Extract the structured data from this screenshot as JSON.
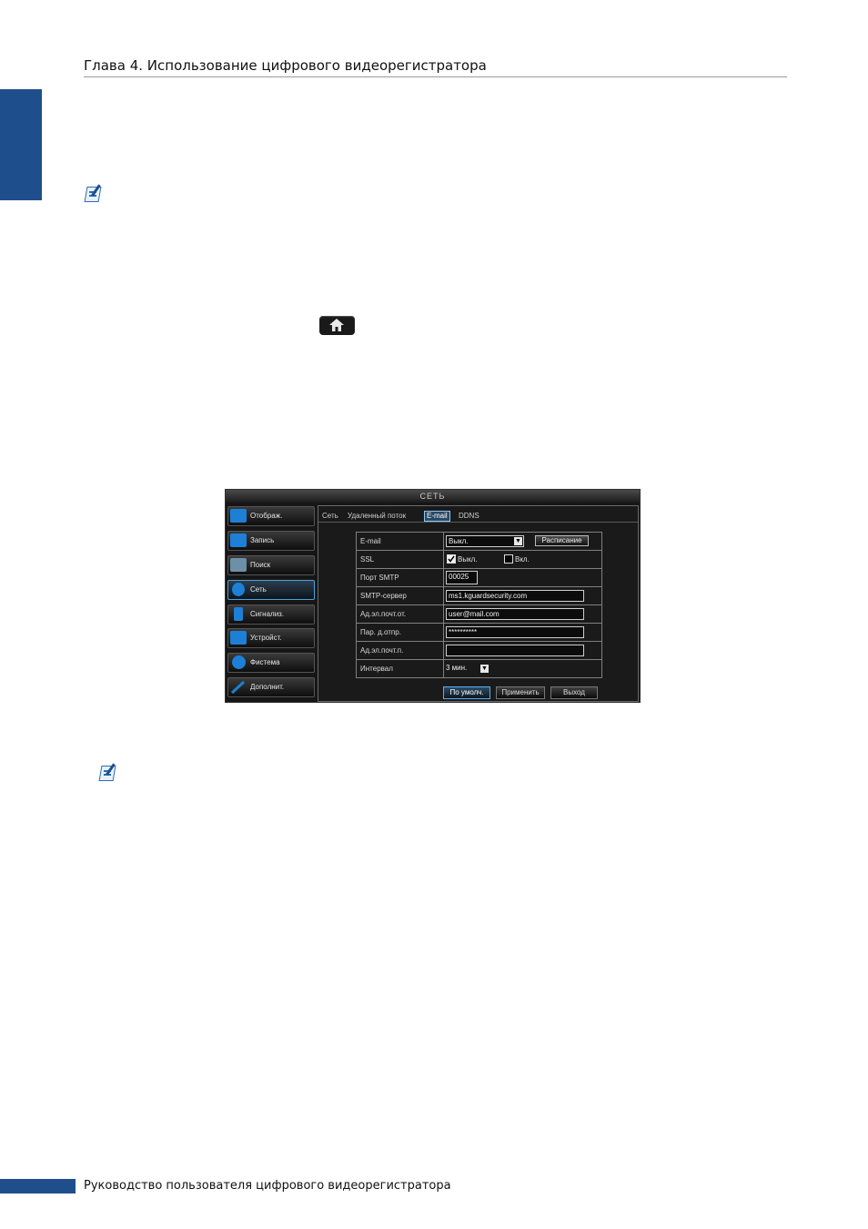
{
  "header": {
    "title": "Глава 4. Использование цифрового видеорегистратора"
  },
  "footer": {
    "text": "Руководство пользователя цифрового видеорегистратора"
  },
  "colors": {
    "accent": "#1f4e8c",
    "dvr_background": "#161616",
    "dvr_highlight": "#4aa3e0"
  },
  "icons": {
    "note": "note-pencil-icon",
    "home": "home-icon"
  },
  "dvr": {
    "title": "СЕТЬ",
    "menu": [
      {
        "label": "Отображ.",
        "icon": "display-icon",
        "icon_color": "#1e7fd6"
      },
      {
        "label": "Запись",
        "icon": "record-icon",
        "icon_color": "#1e7fd6"
      },
      {
        "label": "Поиск",
        "icon": "search-icon",
        "icon_color": "#6e8fa8"
      },
      {
        "label": "Сеть",
        "icon": "network-icon",
        "icon_color": "#1e7fd6"
      },
      {
        "label": "Сигнализ.",
        "icon": "alarm-icon",
        "icon_color": "#1e7fd6"
      },
      {
        "label": "Устройст.",
        "icon": "device-icon",
        "icon_color": "#1e7fd6"
      },
      {
        "label": "Фистема",
        "icon": "gear-icon",
        "icon_color": "#1e7fd6"
      },
      {
        "label": "Дополнит.",
        "icon": "tools-icon",
        "icon_color": "#1e7fd6"
      }
    ],
    "tabs": [
      "Сеть",
      "Удаленный поток",
      "E-mail",
      "DDNS"
    ],
    "active_tab": "E-mail",
    "form": {
      "email_label": "E-mail",
      "email_value": "Выкл.",
      "schedule_button": "Расписание",
      "ssl_label": "SSL",
      "ssl_off": "Выкл.",
      "ssl_on": "Вкл.",
      "smtp_port_label": "Порт SMTP",
      "smtp_port_value": "00025",
      "smtp_server_label": "SMTP-сервер",
      "smtp_server_value": "ms1.kguardsecurity.com",
      "from_label": "Ад.эл.почт.от.",
      "from_value": "user@mail.com",
      "password_label": "Пар. д.отпр.",
      "password_value": "**********",
      "to_label": "Ад.эл.почт.п.",
      "to_value": "",
      "interval_label": "Интервал",
      "interval_value": "3 мин."
    },
    "buttons": {
      "default": "По умолч.",
      "apply": "Применить",
      "exit": "Выход"
    }
  }
}
